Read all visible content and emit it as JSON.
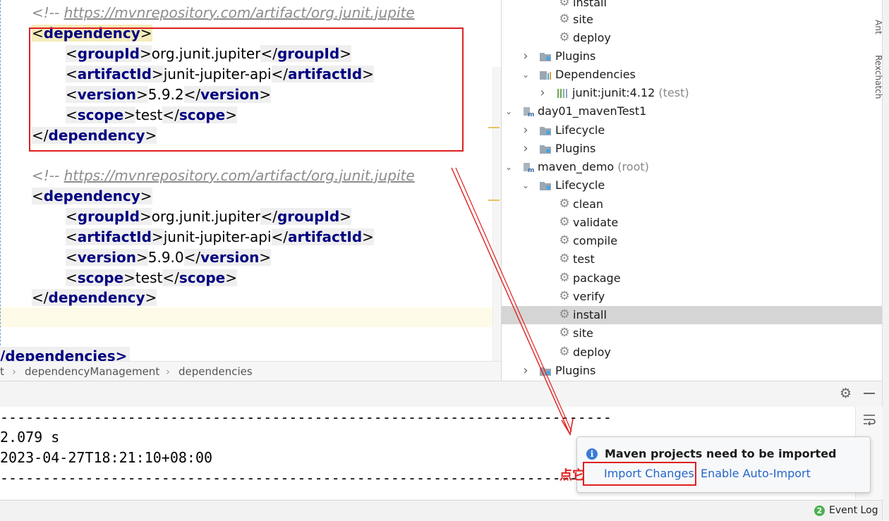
{
  "editor": {
    "comment_prefix": "<!-- ",
    "comment_url": "https://mvnrepository.com/artifact/org.junit.jupite",
    "block1": {
      "open": "dependency",
      "groupId_tag": "groupId",
      "groupId_val": "org.junit.jupiter",
      "artifactId_tag": "artifactId",
      "artifactId_val": "junit-jupiter-api",
      "version_tag": "version",
      "version_val": "5.9.2",
      "scope_tag": "scope",
      "scope_val": "test",
      "close": "dependency"
    },
    "block2": {
      "open": "dependency",
      "groupId_tag": "groupId",
      "groupId_val": "org.junit.jupiter",
      "artifactId_tag": "artifactId",
      "artifactId_val": "junit-jupiter-api",
      "version_tag": "version",
      "version_val": "5.9.0",
      "scope_tag": "scope",
      "scope_val": "test",
      "close": "dependency"
    },
    "closing_partial": "/dependencies>"
  },
  "breadcrumb": {
    "lead": "t",
    "items": [
      "dependencyManagement",
      "dependencies"
    ]
  },
  "maven_tree": {
    "rows": [
      {
        "label": "install",
        "kind": "gear"
      },
      {
        "label": "site",
        "kind": "gear"
      },
      {
        "label": "deploy",
        "kind": "gear"
      },
      {
        "label": "Plugins",
        "kind": "folder"
      },
      {
        "label": "Dependencies",
        "kind": "deps"
      },
      {
        "label": "junit:junit:4.12",
        "suffix": "(test)",
        "kind": "lib"
      },
      {
        "label": "day01_mavenTest1",
        "kind": "module"
      },
      {
        "label": "Lifecycle",
        "kind": "folder"
      },
      {
        "label": "Plugins",
        "kind": "folder"
      },
      {
        "label": "maven_demo",
        "suffix": "(root)",
        "kind": "module"
      },
      {
        "label": "Lifecycle",
        "kind": "folder"
      },
      {
        "label": "clean",
        "kind": "gear"
      },
      {
        "label": "validate",
        "kind": "gear"
      },
      {
        "label": "compile",
        "kind": "gear"
      },
      {
        "label": "test",
        "kind": "gear"
      },
      {
        "label": "package",
        "kind": "gear"
      },
      {
        "label": "verify",
        "kind": "gear"
      },
      {
        "label": "install",
        "kind": "gear",
        "selected": true
      },
      {
        "label": "site",
        "kind": "gear"
      },
      {
        "label": "deploy",
        "kind": "gear"
      },
      {
        "label": "Plugins",
        "kind": "folder"
      }
    ]
  },
  "right_strip": {
    "tab1": "Ant",
    "tab2": "Rexchatch"
  },
  "console": {
    "separator": "------------------------------------------------------------------------",
    "time": "2.079 s",
    "finished": "2023-04-27T18:21:10+08:00"
  },
  "notification": {
    "title": "Maven projects need to be imported",
    "import_changes": "Import Changes",
    "enable_auto_import": "Enable Auto-Import",
    "annotation": "点它"
  },
  "statusbar": {
    "event_count": "2",
    "event_log": "Event Log"
  },
  "colors": {
    "tag": "#000080",
    "comment": "#8c8c8c",
    "annotation_red": "#e02020",
    "link": "#2566c8"
  }
}
